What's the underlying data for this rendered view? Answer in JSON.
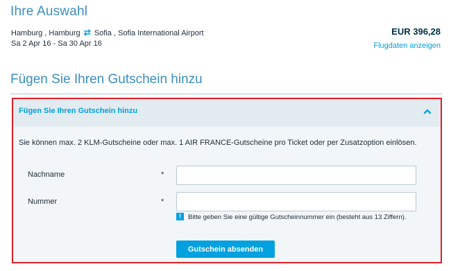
{
  "selection": {
    "title": "Ihre Auswahl",
    "origin": "Hamburg , Hamburg",
    "destination": "Sofia , Sofia International Airport",
    "swap_icon": "⇄",
    "dates": "Sa 2 Apr 16 - Sa 30 Apr 16",
    "price": "EUR 396,28",
    "flight_link": "Flugdaten anzeigen"
  },
  "voucher": {
    "heading": "Fügen Sie Ihren Gutschein hinzu",
    "panel_title": "Fügen Sie Ihren Gutschein hinzu",
    "info_text": "Sie können max. 2 KLM-Gutscheine oder max. 1 AIR FRANCE-Gutscheine pro Ticket oder per Zusatzoption einlösen.",
    "fields": [
      {
        "label": "Nachname",
        "required": "*",
        "value": ""
      },
      {
        "label": "Nummer",
        "required": "*",
        "value": ""
      }
    ],
    "warning_symbol": "!",
    "error_text": "Bitte geben Sie eine gültige Gutscheinnummer ein (besteht aus 13 Ziffern).",
    "submit_label": "Gutschein absenden"
  },
  "colors": {
    "accent": "#00a1de",
    "heading": "#3a8fbf",
    "highlight_border": "#dc1f26",
    "panel_bg": "#f2f6f8"
  }
}
